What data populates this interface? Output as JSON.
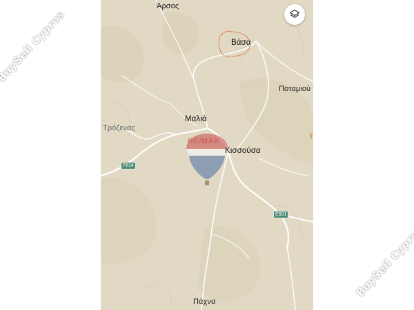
{
  "places": {
    "arsos": "Άρσος",
    "vasa": "Βάσα",
    "potamiou": "Ποταμιού",
    "trozenas": "Τρόζενας",
    "malia": "Μαλιά",
    "kissousa": "Κισσούσα",
    "pachna": "Πάχνα"
  },
  "roads": {
    "f614": "F614",
    "e601": "E601"
  },
  "logo_text": "RE/MAX",
  "watermark_text": "BuySell Cyprus",
  "layers_icon": "layers-icon",
  "colors": {
    "terrain": "#e1d9c3",
    "road": "#ffffff",
    "shield": "#4f8a73",
    "boundary": "#e0623a",
    "logo_red": "#c84a4a",
    "logo_blue": "#4a6fa5"
  }
}
